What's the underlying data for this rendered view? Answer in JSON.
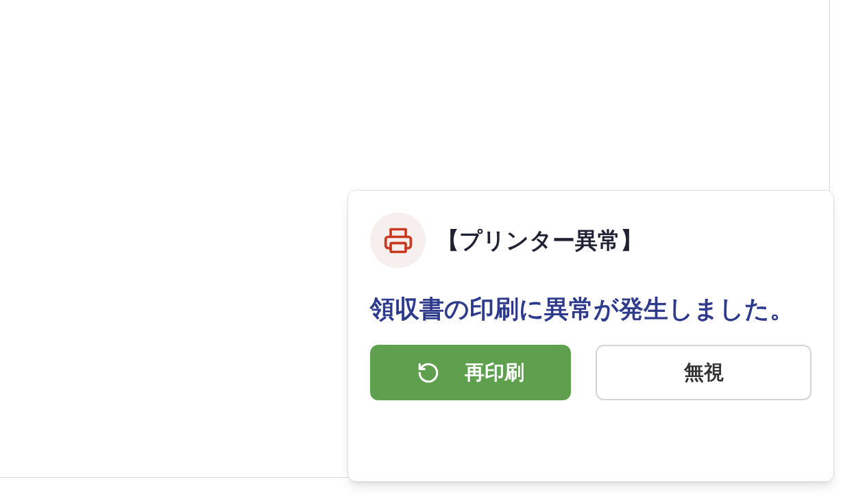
{
  "notification": {
    "title": "【プリンター異常】",
    "message": "領収書の印刷に異常が発生しました。",
    "buttons": [
      {
        "kind": "primary",
        "label": "再印刷"
      },
      {
        "kind": "secondary",
        "label": "無視"
      }
    ]
  }
}
